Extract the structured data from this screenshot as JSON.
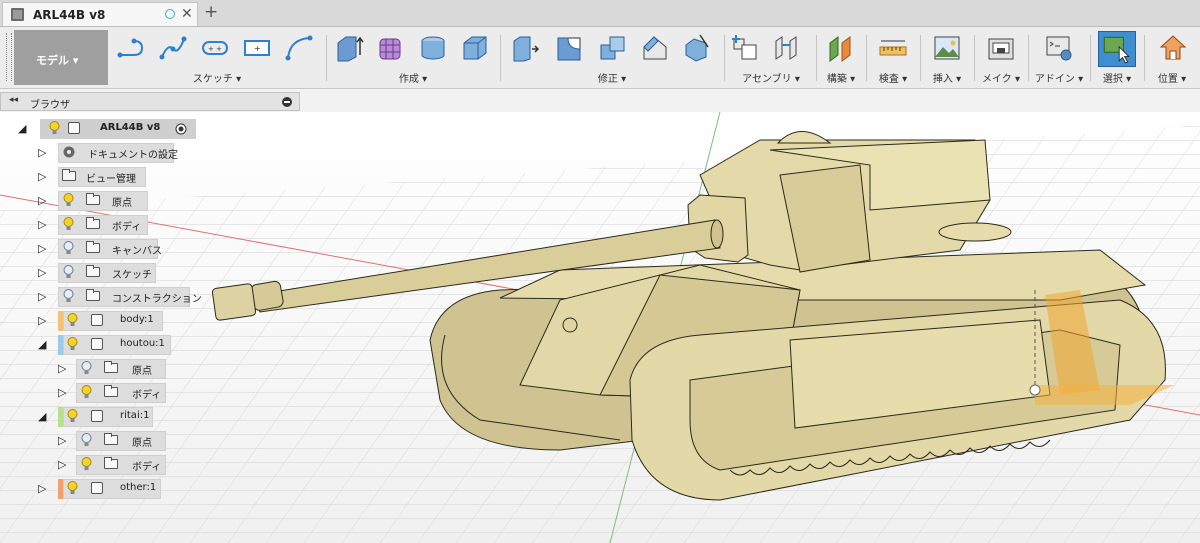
{
  "tab": {
    "title": "ARL44B v8",
    "close": "✕",
    "new": "+"
  },
  "ribbon": {
    "workspace": "モデル ▾",
    "groups": [
      {
        "label": "スケッチ ▾"
      },
      {
        "label": "作成 ▾"
      },
      {
        "label": "修正 ▾"
      },
      {
        "label": "アセンブリ ▾"
      },
      {
        "label": "構築 ▾"
      },
      {
        "label": "検査 ▾"
      },
      {
        "label": "挿入 ▾"
      },
      {
        "label": "メイク ▾"
      },
      {
        "label": "アドイン ▾"
      },
      {
        "label": "選択 ▾"
      },
      {
        "label": "位置 ▾"
      }
    ]
  },
  "browser": {
    "arrows": "◂◂",
    "title": "ブラウザ"
  },
  "tree": [
    {
      "label": "ARL44B v8",
      "kind": "root"
    },
    {
      "label": "ドキュメントの設定",
      "kind": "settings"
    },
    {
      "label": "ビュー管理",
      "kind": "folder"
    },
    {
      "label": "原点",
      "kind": "folder"
    },
    {
      "label": "ボディ",
      "kind": "folder"
    },
    {
      "label": "キャンバス",
      "kind": "folder"
    },
    {
      "label": "スケッチ",
      "kind": "folder"
    },
    {
      "label": "コンストラクション",
      "kind": "folder"
    },
    {
      "label": "body:1",
      "kind": "component",
      "color": "#f2c27a"
    },
    {
      "label": "houtou:1",
      "kind": "component",
      "color": "#9ec9e8"
    },
    {
      "label": "原点",
      "kind": "folder"
    },
    {
      "label": "ボディ",
      "kind": "folder"
    },
    {
      "label": "ritai:1",
      "kind": "component",
      "color": "#b8e08a"
    },
    {
      "label": "原点",
      "kind": "folder"
    },
    {
      "label": "ボディ",
      "kind": "folder"
    },
    {
      "label": "other:1",
      "kind": "component",
      "color": "#f2a070"
    }
  ],
  "colors": {
    "tank": "#ddd2a2",
    "tank_dark": "#b9ab78",
    "accent": "#2f7fd0",
    "select": "#6aa74f"
  }
}
